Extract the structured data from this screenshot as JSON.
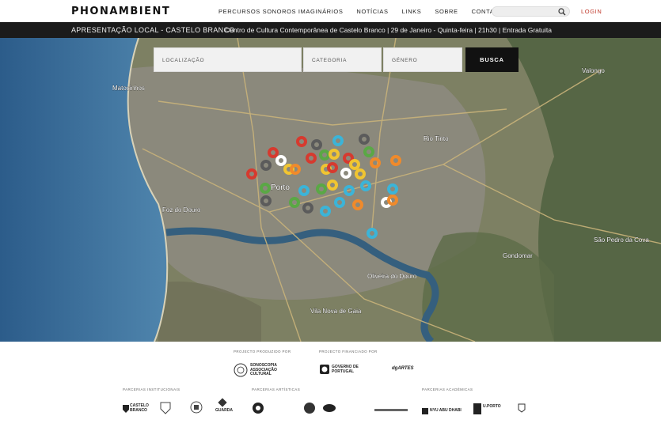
{
  "header": {
    "logo": "PHONAMBIENT",
    "nav": [
      "PERCURSOS SONOROS IMAGINÁRIOS",
      "NOTÍCIAS",
      "LINKS",
      "SOBRE",
      "CONTACTOS"
    ],
    "search_placeholder": "",
    "login": "LOGIN"
  },
  "announcement": {
    "title": "APRESENTAÇÃO LOCAL - CASTELO BRANCO",
    "details": "Centro de Cultura Contemporânea de Castelo Branco | 29 de Janeiro - Quinta-feira | 21h30 | Entrada Gratuita"
  },
  "filters": {
    "location": "LOCALIZAÇÃO",
    "category": "CATEGORIA",
    "genre": "GÉNERO",
    "button": "BUSCA"
  },
  "map": {
    "labels": [
      "Porto",
      "Matosinhos",
      "Foz do Douro",
      "Vila Nova de Gaia",
      "Valongo",
      "Gondomar",
      "Rio Tinto",
      "Oliveira do Douro",
      "São Pedro da Cova"
    ],
    "marker_colors": {
      "red": "#d63a2f",
      "orange": "#f08a2b",
      "yellow": "#f1c531",
      "green": "#5aa845",
      "cyan": "#3bb4d8",
      "gray": "#5b5b5b",
      "white": "#ffffff"
    }
  },
  "footer": {
    "produced_by": "PROJECTO PRODUZIDO POR",
    "financed_by": "PROJECTO FINANCIADO POR",
    "institutional": "PARCERIAS INSTITUCIONAIS",
    "artistic": "PARCERIAS ARTÍSTICAS",
    "academic": "PARCERIAS ACADÉMICAS",
    "partners": {
      "sonoscopia": "SONOSCOPIA ASSOCIAÇÃO CULTURAL",
      "governo": "GOVERNO DE PORTUGAL",
      "dgartes": "dgARTES",
      "castelo_branco": "CASTELO BRANCO",
      "guarda": "GUARDA",
      "nyu": "NYU ABU DHABI",
      "porto": "U.PORTO"
    }
  }
}
